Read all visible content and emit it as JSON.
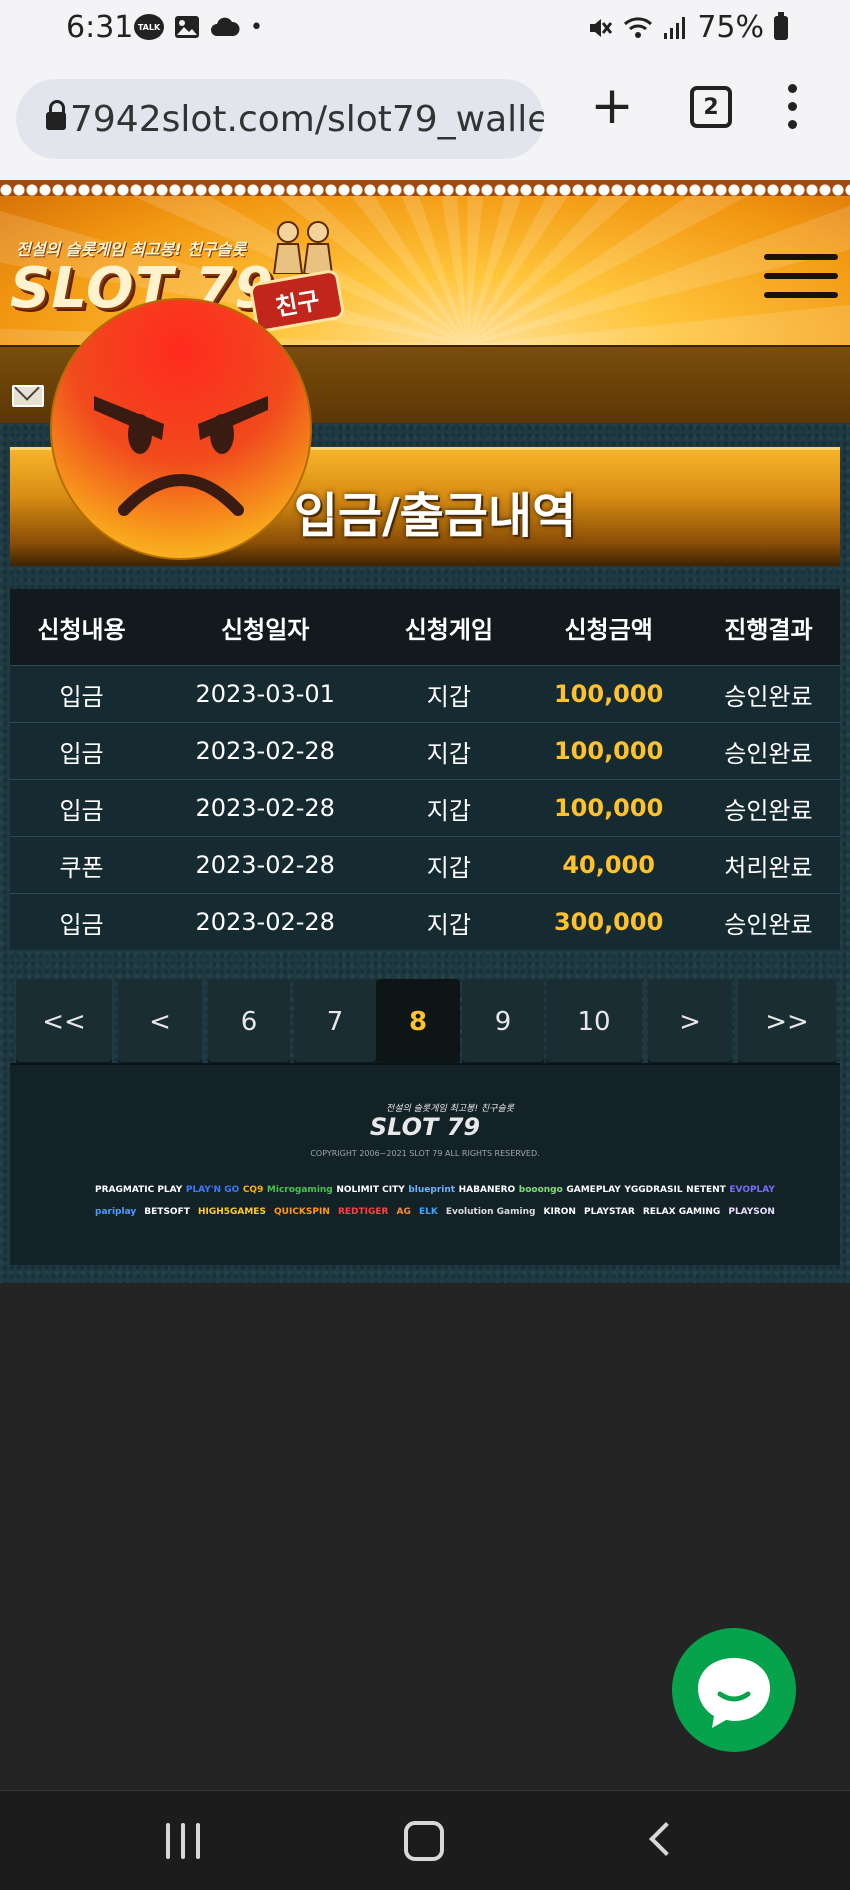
{
  "status_bar": {
    "time": "6:31",
    "talk_badge": "TALK",
    "dot": "•",
    "battery": "75%"
  },
  "browser": {
    "url": "7942slot.com/slot79_walle",
    "tab_count": "2"
  },
  "header": {
    "logo_tagline": "전설의 슬롯게임 최고봉! 친구슬롯",
    "logo_text": "SLOT 79",
    "logo_badge": "친구"
  },
  "page_title": "입금/출금내역",
  "table": {
    "headers": [
      "신청내용",
      "신청일자",
      "신청게임",
      "신청금액",
      "진행결과"
    ],
    "rows": [
      [
        "입금",
        "2023-03-01",
        "지갑",
        "100,000",
        "승인완료"
      ],
      [
        "입금",
        "2023-02-28",
        "지갑",
        "100,000",
        "승인완료"
      ],
      [
        "입금",
        "2023-02-28",
        "지갑",
        "100,000",
        "승인완료"
      ],
      [
        "쿠폰",
        "2023-02-28",
        "지갑",
        "40,000",
        "처리완료"
      ],
      [
        "입금",
        "2023-02-28",
        "지갑",
        "300,000",
        "승인완료"
      ]
    ]
  },
  "pagination": {
    "first": "<<",
    "prev": "<",
    "pages": [
      "6",
      "7",
      "8",
      "9",
      "10"
    ],
    "current": "8",
    "next": ">",
    "last": ">>"
  },
  "footer": {
    "tagline": "전설의 슬롯게임 최고봉! 친구슬롯",
    "logo_text": "SLOT 79",
    "copyright": "COPYRIGHT  2006~2021 SLOT 79 ALL RIGHTS RESERVED.",
    "providers_row1": [
      "PRAGMATIC PLAY",
      "PLAY'N GO",
      "CQ9",
      "Microgaming",
      "NOLIMIT CITY",
      "blueprint",
      "HABANERO",
      "booongo",
      "GAMEPLAY",
      "YGGDRASIL",
      "NETENT",
      "EVOPLAY"
    ],
    "providers_row2": [
      "pariplay",
      "BETSOFT",
      "HIGH5GAMES",
      "QUICKSPIN",
      "REDTIGER",
      "AG",
      "ELK",
      "Evolution Gaming",
      "KIRON",
      "PLAYSTAR",
      "RELAX GAMING",
      "PLAYSON"
    ]
  },
  "colors": {
    "amount": "#ffc22d",
    "chat": "#07a24c",
    "header": "#f29711"
  }
}
